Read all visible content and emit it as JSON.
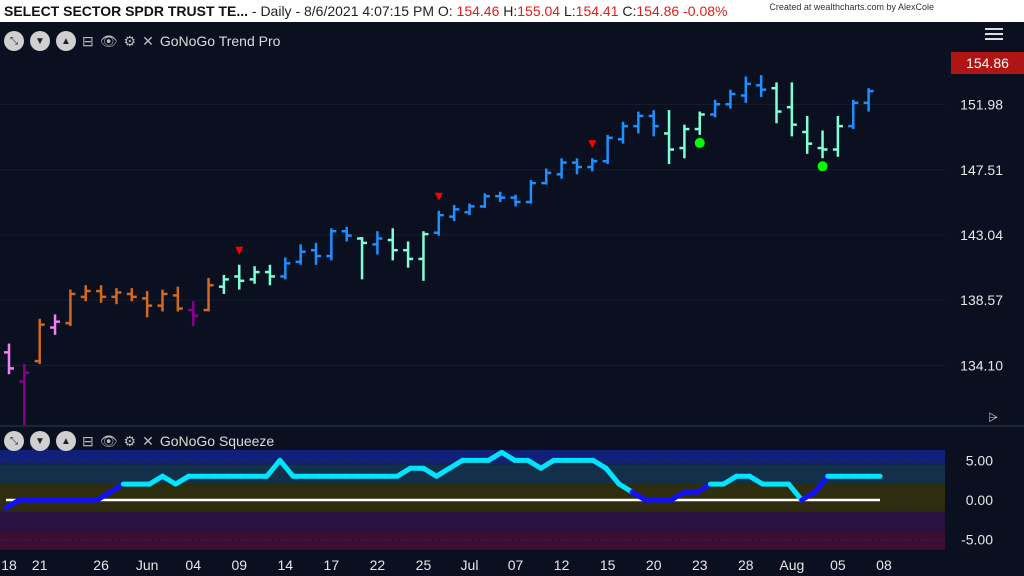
{
  "header": {
    "symbol": "SELECT SECTOR SPDR TRUST TE...",
    "meta": "- Daily - 8/6/2021 4:07:15 PM O:",
    "open": "154.46",
    "high_label": "H:",
    "high": "155.04",
    "low_label": "L:",
    "low": "154.41",
    "close_label": "C:",
    "close": "154.86",
    "change": "-0.08%",
    "credit": "Created at wealthcharts.com by AlexCole"
  },
  "main_panel": {
    "indicator_name": "GoNoGo Trend Pro",
    "last_price_label": "154.86"
  },
  "squeeze_panel": {
    "indicator_name": "GoNoGo Squeeze"
  },
  "colors": {
    "background": "#0b1020",
    "strong_go": "#1e8fff",
    "weak_go": "#7fffd4",
    "nogo": "#ee82ee",
    "strong_nogo": "#8b008b",
    "amber": "#d2691e",
    "squeeze_cyan": "#00e5ff",
    "squeeze_blue": "#1010ff",
    "down_marker": "#ff0000",
    "go_dot": "#00ff00"
  },
  "chart_data": [
    {
      "type": "ohlc",
      "title": "GoNoGo Trend Pro",
      "dates": [
        "05-18",
        "05-19",
        "05-20",
        "05-21",
        "05-24",
        "05-25",
        "05-26",
        "05-27",
        "05-28",
        "06-01",
        "06-02",
        "06-03",
        "06-04",
        "06-07",
        "06-08",
        "06-09",
        "06-10",
        "06-11",
        "06-14",
        "06-15",
        "06-16",
        "06-17",
        "06-18",
        "06-21",
        "06-22",
        "06-23",
        "06-24",
        "06-25",
        "06-28",
        "06-29",
        "06-30",
        "07-01",
        "07-02",
        "07-06",
        "07-07",
        "07-08",
        "07-09",
        "07-12",
        "07-13",
        "07-14",
        "07-15",
        "07-16",
        "07-19",
        "07-20",
        "07-21",
        "07-22",
        "07-23",
        "07-26",
        "07-27",
        "07-28",
        "07-29",
        "07-30",
        "08-02",
        "08-03",
        "08-04",
        "08-05",
        "08-06"
      ],
      "x_tick_labels": [
        "18",
        "21",
        "26",
        "Jun",
        "04",
        "09",
        "14",
        "17",
        "22",
        "25",
        "Jul",
        "07",
        "12",
        "15",
        "20",
        "23",
        "28",
        "Aug",
        "05",
        "08"
      ],
      "y_tick_labels": [
        "134.10",
        "138.57",
        "143.04",
        "147.51",
        "151.98"
      ],
      "ylim": [
        130.5,
        157.5
      ],
      "bars": [
        {
          "o": 135.0,
          "h": 135.6,
          "l": 133.5,
          "c": 133.9,
          "color": "nogo"
        },
        {
          "o": 133.0,
          "h": 134.2,
          "l": 129.9,
          "c": 133.6,
          "color": "strong_nogo"
        },
        {
          "o": 134.4,
          "h": 137.3,
          "l": 134.2,
          "c": 136.9,
          "color": "amber"
        },
        {
          "o": 136.7,
          "h": 137.6,
          "l": 136.2,
          "c": 137.1,
          "color": "nogo"
        },
        {
          "o": 137.0,
          "h": 139.3,
          "l": 136.8,
          "c": 139.0,
          "color": "amber"
        },
        {
          "o": 138.8,
          "h": 139.6,
          "l": 138.5,
          "c": 139.2,
          "color": "amber"
        },
        {
          "o": 139.2,
          "h": 139.6,
          "l": 138.4,
          "c": 138.8,
          "color": "amber"
        },
        {
          "o": 138.8,
          "h": 139.4,
          "l": 138.3,
          "c": 139.1,
          "color": "amber"
        },
        {
          "o": 139.0,
          "h": 139.4,
          "l": 138.5,
          "c": 138.8,
          "color": "amber"
        },
        {
          "o": 138.7,
          "h": 139.2,
          "l": 137.4,
          "c": 138.2,
          "color": "amber"
        },
        {
          "o": 138.2,
          "h": 139.3,
          "l": 137.8,
          "c": 139.0,
          "color": "amber"
        },
        {
          "o": 138.9,
          "h": 139.5,
          "l": 137.8,
          "c": 138.0,
          "color": "amber"
        },
        {
          "o": 137.9,
          "h": 138.5,
          "l": 136.8,
          "c": 137.5,
          "color": "strong_nogo"
        },
        {
          "o": 137.9,
          "h": 140.1,
          "l": 137.8,
          "c": 139.6,
          "color": "amber"
        },
        {
          "o": 139.5,
          "h": 140.3,
          "l": 139.0,
          "c": 140.0,
          "color": "weak_go"
        },
        {
          "o": 140.2,
          "h": 141.0,
          "l": 139.3,
          "c": 139.9,
          "color": "weak_go"
        },
        {
          "o": 140.0,
          "h": 140.9,
          "l": 139.7,
          "c": 140.5,
          "color": "weak_go"
        },
        {
          "o": 140.5,
          "h": 141.0,
          "l": 139.6,
          "c": 140.2,
          "color": "weak_go"
        },
        {
          "o": 140.2,
          "h": 141.5,
          "l": 140.0,
          "c": 141.1,
          "color": "strong_go"
        },
        {
          "o": 141.2,
          "h": 142.4,
          "l": 141.0,
          "c": 141.9,
          "color": "strong_go"
        },
        {
          "o": 142.0,
          "h": 142.5,
          "l": 141.0,
          "c": 141.6,
          "color": "strong_go"
        },
        {
          "o": 141.6,
          "h": 143.5,
          "l": 141.3,
          "c": 143.3,
          "color": "strong_go"
        },
        {
          "o": 143.3,
          "h": 143.6,
          "l": 142.6,
          "c": 143.0,
          "color": "strong_go"
        },
        {
          "o": 142.8,
          "h": 142.9,
          "l": 140.0,
          "c": 142.5,
          "color": "weak_go"
        },
        {
          "o": 142.4,
          "h": 143.3,
          "l": 141.7,
          "c": 142.8,
          "color": "strong_go"
        },
        {
          "o": 142.7,
          "h": 143.5,
          "l": 141.3,
          "c": 142.0,
          "color": "weak_go"
        },
        {
          "o": 142.0,
          "h": 142.6,
          "l": 140.8,
          "c": 141.4,
          "color": "weak_go"
        },
        {
          "o": 141.4,
          "h": 143.3,
          "l": 139.9,
          "c": 143.1,
          "color": "weak_go"
        },
        {
          "o": 143.2,
          "h": 144.7,
          "l": 143.0,
          "c": 144.4,
          "color": "strong_go"
        },
        {
          "o": 144.3,
          "h": 145.1,
          "l": 144.0,
          "c": 144.8,
          "color": "strong_go"
        },
        {
          "o": 144.6,
          "h": 145.2,
          "l": 144.4,
          "c": 145.0,
          "color": "strong_go"
        },
        {
          "o": 145.0,
          "h": 145.9,
          "l": 144.9,
          "c": 145.7,
          "color": "strong_go"
        },
        {
          "o": 145.7,
          "h": 146.0,
          "l": 145.3,
          "c": 145.6,
          "color": "strong_go"
        },
        {
          "o": 145.6,
          "h": 145.8,
          "l": 145.0,
          "c": 145.3,
          "color": "strong_go"
        },
        {
          "o": 145.3,
          "h": 146.8,
          "l": 145.2,
          "c": 146.6,
          "color": "strong_go"
        },
        {
          "o": 146.6,
          "h": 147.6,
          "l": 146.5,
          "c": 147.3,
          "color": "strong_go"
        },
        {
          "o": 147.2,
          "h": 148.3,
          "l": 146.9,
          "c": 148.0,
          "color": "strong_go"
        },
        {
          "o": 148.0,
          "h": 148.3,
          "l": 147.2,
          "c": 147.7,
          "color": "strong_go"
        },
        {
          "o": 147.7,
          "h": 148.3,
          "l": 147.4,
          "c": 148.1,
          "color": "strong_go"
        },
        {
          "o": 148.1,
          "h": 149.9,
          "l": 147.9,
          "c": 149.7,
          "color": "strong_go"
        },
        {
          "o": 149.6,
          "h": 150.8,
          "l": 149.3,
          "c": 150.5,
          "color": "strong_go"
        },
        {
          "o": 150.5,
          "h": 151.5,
          "l": 150.0,
          "c": 151.2,
          "color": "strong_go"
        },
        {
          "o": 151.2,
          "h": 151.6,
          "l": 149.8,
          "c": 150.5,
          "color": "strong_go"
        },
        {
          "o": 150.0,
          "h": 151.6,
          "l": 147.9,
          "c": 148.9,
          "color": "weak_go"
        },
        {
          "o": 149.0,
          "h": 150.6,
          "l": 148.3,
          "c": 150.3,
          "color": "weak_go"
        },
        {
          "o": 150.3,
          "h": 151.5,
          "l": 149.9,
          "c": 151.3,
          "color": "weak_go"
        },
        {
          "o": 151.3,
          "h": 152.3,
          "l": 151.1,
          "c": 152.0,
          "color": "strong_go"
        },
        {
          "o": 152.0,
          "h": 153.0,
          "l": 151.7,
          "c": 152.7,
          "color": "strong_go"
        },
        {
          "o": 152.6,
          "h": 153.9,
          "l": 152.1,
          "c": 153.4,
          "color": "strong_go"
        },
        {
          "o": 153.3,
          "h": 154.0,
          "l": 152.5,
          "c": 153.0,
          "color": "strong_go"
        },
        {
          "o": 153.1,
          "h": 153.5,
          "l": 150.7,
          "c": 151.5,
          "color": "weak_go"
        },
        {
          "o": 151.8,
          "h": 153.5,
          "l": 149.8,
          "c": 150.6,
          "color": "weak_go"
        },
        {
          "o": 150.1,
          "h": 151.2,
          "l": 148.6,
          "c": 149.3,
          "color": "weak_go"
        },
        {
          "o": 149.0,
          "h": 150.2,
          "l": 148.3,
          "c": 148.9,
          "color": "weak_go"
        },
        {
          "o": 148.9,
          "h": 151.2,
          "l": 148.4,
          "c": 150.5,
          "color": "weak_go"
        },
        {
          "o": 150.5,
          "h": 152.3,
          "l": 150.3,
          "c": 152.1,
          "color": "strong_go"
        },
        {
          "o": 152.1,
          "h": 153.1,
          "l": 151.5,
          "c": 152.9,
          "color": "strong_go"
        }
      ],
      "down_markers_at": [
        15,
        28,
        38
      ],
      "go_dots_at": [
        45,
        53
      ]
    },
    {
      "type": "line",
      "title": "GoNoGo Squeeze",
      "y_tick_labels": [
        "5.00",
        "0.00",
        "-5.00"
      ],
      "ylim": [
        -6.3,
        6.3
      ],
      "zero_line": 0,
      "values": [
        -1,
        0,
        0,
        0,
        0,
        0,
        0,
        0,
        1,
        2,
        2,
        2,
        3,
        2,
        3,
        3,
        3,
        3,
        3,
        3,
        3,
        5,
        3,
        3,
        3,
        3,
        3,
        3,
        3,
        3,
        3,
        4,
        4,
        3,
        4,
        5,
        5,
        5,
        6,
        5,
        5,
        4,
        5,
        5,
        5,
        5,
        4,
        2,
        1,
        0,
        0,
        0,
        1,
        1,
        2,
        2,
        3,
        3,
        2,
        2,
        2,
        0,
        1,
        3,
        3,
        3,
        3,
        3
      ],
      "segment_colors": [
        "squeeze_blue",
        "squeeze_cyan",
        "squeeze_blue"
      ]
    }
  ]
}
